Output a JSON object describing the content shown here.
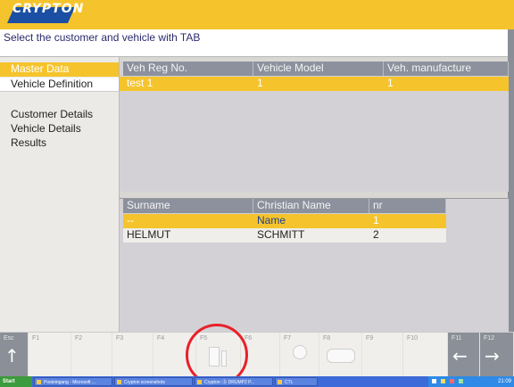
{
  "logo": {
    "text": "CRYPTON"
  },
  "instruction": "Select the customer and vehicle with TAB",
  "sidebar": {
    "items": [
      {
        "label": "Master Data",
        "state": "active"
      },
      {
        "label": "Vehicle Definition",
        "state": "selected"
      },
      {
        "label": "Customer Details",
        "state": "normal"
      },
      {
        "label": "Vehicle Details",
        "state": "normal"
      },
      {
        "label": "Results",
        "state": "normal"
      }
    ]
  },
  "vehicle_table": {
    "columns": [
      "Veh Reg No.",
      "Vehicle Model",
      "Veh. manufacture"
    ],
    "rows": [
      {
        "reg": "test 1",
        "model": "1",
        "manufacture": "1",
        "selected": true
      }
    ]
  },
  "customer_table": {
    "columns": [
      "Surname",
      "Christian Name",
      "nr"
    ],
    "rows": [
      {
        "surname": "--",
        "name": "Name",
        "nr": "1",
        "selected": true
      },
      {
        "surname": "HELMUT",
        "name": "SCHMITT",
        "nr": "2",
        "selected": false
      }
    ]
  },
  "function_keys": {
    "esc": "Esc",
    "f1": "F1",
    "f2": "F2",
    "f3": "F3",
    "f4": "F4",
    "f5": "F5",
    "f6": "F6",
    "f7": "F7",
    "f8": "F8",
    "f9": "F9",
    "f10": "F10",
    "f11": "F11",
    "f12": "F12",
    "esc_icon": "up-arrow-icon",
    "f11_icon": "left-arrow-icon",
    "f12_icon": "right-arrow-icon"
  },
  "taskbar": {
    "start": "Start",
    "tasks": [
      "Posteingang - Microsoft ...",
      "Crypton screenshots",
      "Crypton: Ⓢ DRUMP2 P...",
      "CTL"
    ],
    "clock": "21:09"
  },
  "colors": {
    "accent": "#f5c42c",
    "header_gray": "#8c919d",
    "highlight_circle": "#e8202a"
  }
}
